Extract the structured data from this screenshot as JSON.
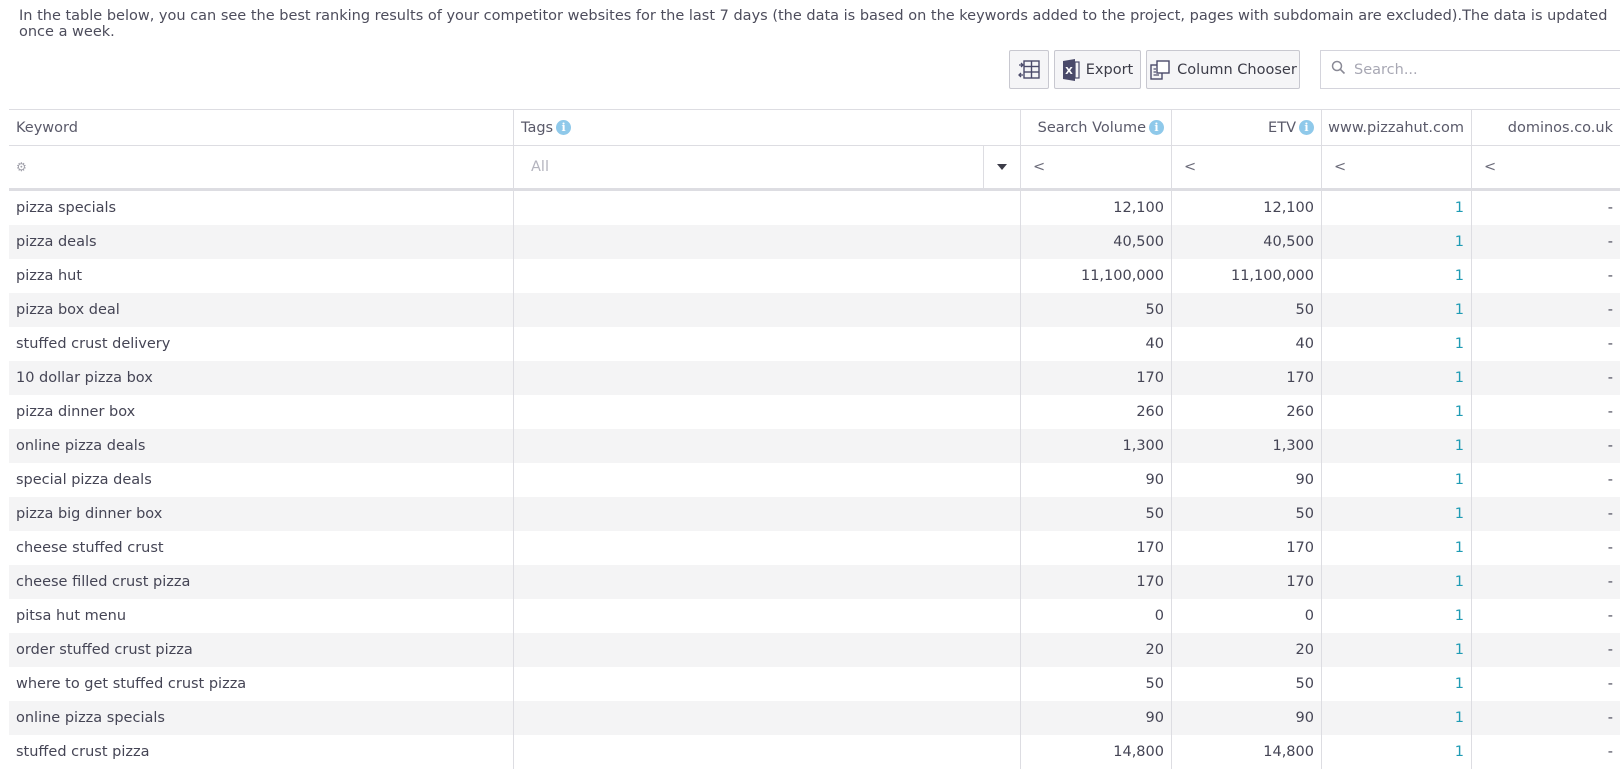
{
  "intro_text": "In the table below, you can see the best ranking results of your competitor websites for the last 7 days (the data is based on the keywords added to the project, pages with subdomain are excluded).The data is updated once a week.",
  "toolbar": {
    "layout_icon": "grid-layout-icon",
    "export_label": "Export",
    "column_chooser_label": "Column Chooser",
    "search_placeholder": "Search..."
  },
  "columns": {
    "keyword": "Keyword",
    "tags": "Tags",
    "search_volume": "Search Volume",
    "etv": "ETV",
    "competitor1": "www.pizzahut.com",
    "competitor2": "dominos.co.uk"
  },
  "filters": {
    "tags_value": "All",
    "op_sv": "<",
    "op_etv": "<",
    "op_c1": "<",
    "op_c2": "<"
  },
  "colors": {
    "rank_link": "#1f9bb4",
    "info_icon": "#8fc9ea",
    "alt_row": "#f4f4f5"
  },
  "rows": [
    {
      "keyword": "pizza specials",
      "tags": "",
      "sv": "12,100",
      "etv": "12,100",
      "c1": "1",
      "c2": "-"
    },
    {
      "keyword": "pizza deals",
      "tags": "",
      "sv": "40,500",
      "etv": "40,500",
      "c1": "1",
      "c2": "-"
    },
    {
      "keyword": "pizza hut",
      "tags": "",
      "sv": "11,100,000",
      "etv": "11,100,000",
      "c1": "1",
      "c2": "-"
    },
    {
      "keyword": "pizza box deal",
      "tags": "",
      "sv": "50",
      "etv": "50",
      "c1": "1",
      "c2": "-"
    },
    {
      "keyword": "stuffed crust delivery",
      "tags": "",
      "sv": "40",
      "etv": "40",
      "c1": "1",
      "c2": "-"
    },
    {
      "keyword": "10 dollar pizza box",
      "tags": "",
      "sv": "170",
      "etv": "170",
      "c1": "1",
      "c2": "-"
    },
    {
      "keyword": "pizza dinner box",
      "tags": "",
      "sv": "260",
      "etv": "260",
      "c1": "1",
      "c2": "-"
    },
    {
      "keyword": "online pizza deals",
      "tags": "",
      "sv": "1,300",
      "etv": "1,300",
      "c1": "1",
      "c2": "-"
    },
    {
      "keyword": "special pizza deals",
      "tags": "",
      "sv": "90",
      "etv": "90",
      "c1": "1",
      "c2": "-"
    },
    {
      "keyword": "pizza big dinner box",
      "tags": "",
      "sv": "50",
      "etv": "50",
      "c1": "1",
      "c2": "-"
    },
    {
      "keyword": "cheese stuffed crust",
      "tags": "",
      "sv": "170",
      "etv": "170",
      "c1": "1",
      "c2": "-"
    },
    {
      "keyword": "cheese filled crust pizza",
      "tags": "",
      "sv": "170",
      "etv": "170",
      "c1": "1",
      "c2": "-"
    },
    {
      "keyword": "pitsa hut menu",
      "tags": "",
      "sv": "0",
      "etv": "0",
      "c1": "1",
      "c2": "-"
    },
    {
      "keyword": "order stuffed crust pizza",
      "tags": "",
      "sv": "20",
      "etv": "20",
      "c1": "1",
      "c2": "-"
    },
    {
      "keyword": "where to get stuffed crust pizza",
      "tags": "",
      "sv": "50",
      "etv": "50",
      "c1": "1",
      "c2": "-"
    },
    {
      "keyword": "online pizza specials",
      "tags": "",
      "sv": "90",
      "etv": "90",
      "c1": "1",
      "c2": "-"
    },
    {
      "keyword": "stuffed crust pizza",
      "tags": "",
      "sv": "14,800",
      "etv": "14,800",
      "c1": "1",
      "c2": "-"
    }
  ]
}
